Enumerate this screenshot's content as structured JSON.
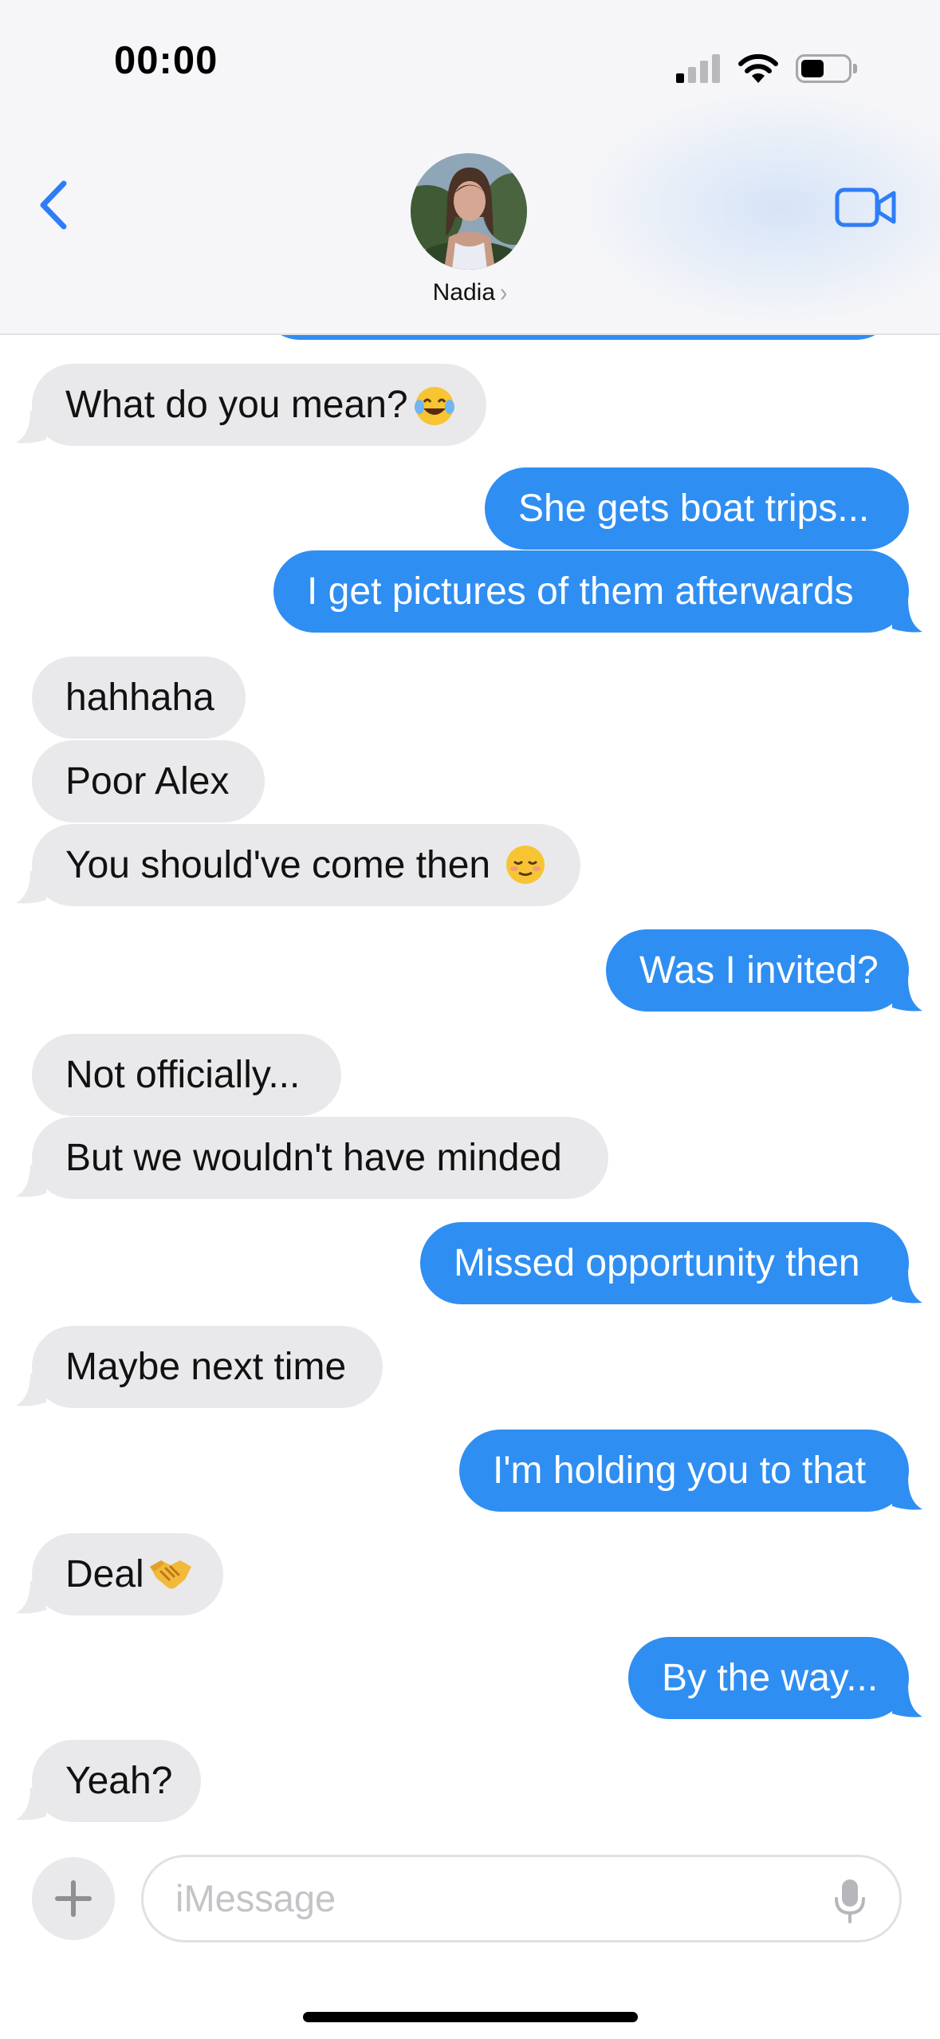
{
  "status_bar": {
    "time": "00:00",
    "icons": [
      "cellular-signal-icon",
      "wifi-icon",
      "battery-icon"
    ]
  },
  "header": {
    "contact_name": "Nadia",
    "chevron": "›",
    "icons": [
      "back-chevron-icon",
      "contact-avatar",
      "video-call-icon"
    ]
  },
  "messages": [
    {
      "side": "out",
      "text": ""
    },
    {
      "side": "in",
      "text": "What do you mean?",
      "emoji": "tears-of-joy-emoji"
    },
    {
      "side": "out",
      "text": "She gets boat trips..."
    },
    {
      "side": "out",
      "text": "I get pictures of them afterwards"
    },
    {
      "side": "in",
      "text": "hahhaha"
    },
    {
      "side": "in",
      "text": "Poor Alex"
    },
    {
      "side": "in",
      "text": "You should've come then",
      "emoji": "relieved-face-emoji"
    },
    {
      "side": "out",
      "text": "Was I invited?"
    },
    {
      "side": "in",
      "text": "Not officially..."
    },
    {
      "side": "in",
      "text": "But we wouldn't have minded"
    },
    {
      "side": "out",
      "text": "Missed opportunity then"
    },
    {
      "side": "in",
      "text": "Maybe next time"
    },
    {
      "side": "out",
      "text": "I'm holding you to that"
    },
    {
      "side": "in",
      "text": "Deal",
      "emoji": "handshake-emoji"
    },
    {
      "side": "out",
      "text": "By the way..."
    },
    {
      "side": "in",
      "text": "Yeah?"
    }
  ],
  "input_bar": {
    "placeholder": "iMessage",
    "icons": [
      "plus-icon",
      "microphone-icon"
    ]
  },
  "colors": {
    "outgoing_bubble": "#2f8ef2",
    "incoming_bubble": "#e9e9eb",
    "accent": "#2f7cf6"
  }
}
